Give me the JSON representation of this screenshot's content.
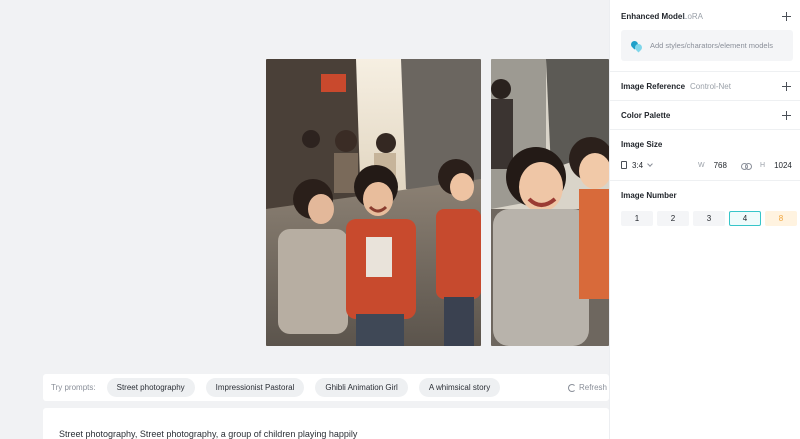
{
  "try_prompts": {
    "label": "Try prompts:",
    "chips": [
      "Street photography",
      "Impressionist Pastoral",
      "Ghibli Animation Girl",
      "A whimsical story"
    ],
    "refresh_label": "Refresh"
  },
  "prompt": {
    "text": "Street photography, Street photography, a group of children playing happily"
  },
  "panel": {
    "enhanced_model": {
      "title": "Enhanced Model",
      "subtitle": "LoRA",
      "add_models_label": "Add styles/charators/element models"
    },
    "image_reference": {
      "title": "Image Reference",
      "subtitle": "Control-Net"
    },
    "color_palette": {
      "title": "Color Palette"
    },
    "image_size": {
      "title": "Image Size",
      "ratio": "3:4",
      "width_label": "W",
      "width": "768",
      "height_label": "H",
      "height": "1024"
    },
    "image_number": {
      "title": "Image Number",
      "options": [
        "1",
        "2",
        "3",
        "4",
        "8"
      ],
      "selected": "4"
    }
  },
  "icons": {
    "plus": "plus-icon",
    "refresh": "refresh-icon",
    "models": "drops-icon",
    "ratio": "portrait-ratio-icon",
    "link": "link-icon",
    "chevron": "chevron-down-icon"
  },
  "colors": {
    "accent": "#37c5c9",
    "warn": "#f0a43a",
    "canvas_bg": "#f1f2f4"
  }
}
